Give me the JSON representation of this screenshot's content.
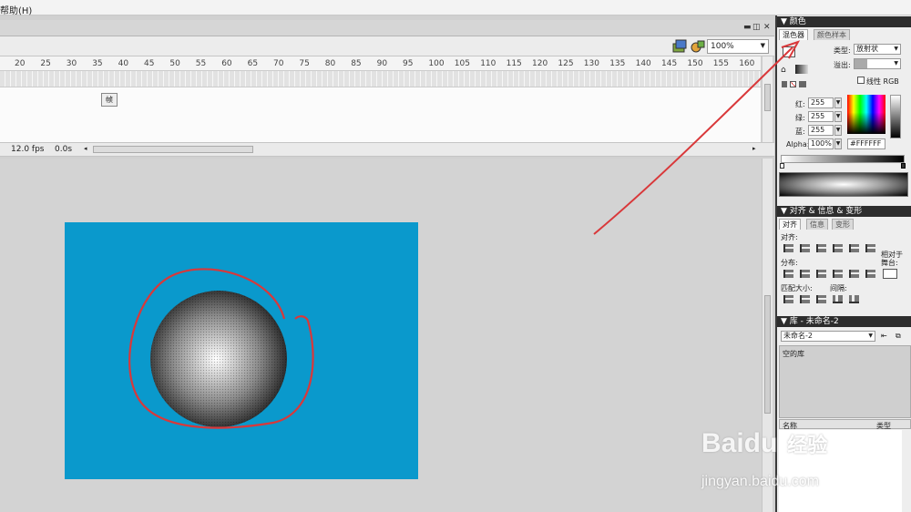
{
  "menu": {
    "help": "帮助(H)"
  },
  "timeline": {
    "zoom": "100%",
    "ruler_ticks": [
      "20",
      "25",
      "30",
      "35",
      "40",
      "45",
      "50",
      "55",
      "60",
      "65",
      "70",
      "75",
      "80",
      "85",
      "90",
      "95",
      "100",
      "105",
      "110",
      "115",
      "120",
      "125",
      "130",
      "135",
      "140",
      "145",
      "150",
      "155",
      "160"
    ],
    "frame_tag": "帧",
    "fps": "12.0 fps",
    "time": "0.0s"
  },
  "color_panel": {
    "title": "颜色",
    "tab_mixer": "混色器",
    "tab_swatches": "颜色样本",
    "type_label": "类型:",
    "type_value": "放射状",
    "overflow_label": "溢出:",
    "linear_rgb_label": "线性 RGB",
    "red_label": "红:",
    "red_value": "255",
    "green_label": "绿:",
    "green_value": "255",
    "blue_label": "蓝:",
    "blue_value": "255",
    "alpha_label": "Alpha:",
    "alpha_value": "100%",
    "hex_value": "#FFFFFF"
  },
  "align_panel": {
    "title": "对齐 & 信息 & 变形",
    "tab_align": "对齐",
    "tab_info": "信息",
    "tab_transform": "变形",
    "align_label": "对齐:",
    "distribute_label": "分布:",
    "match_size_label": "匹配大小:",
    "spacing_label": "间隔:",
    "relative_label": "相对于",
    "stage_label": "舞台:"
  },
  "library_panel": {
    "title": "库 - 未命名-2",
    "doc_select": "未命名-2",
    "empty_text": "空的库",
    "col_name": "名称",
    "col_type": "类型"
  },
  "watermark": {
    "brand": "Baidu",
    "brand_cn": "经验",
    "url": "jingyan.baidu.com"
  },
  "colors": {
    "stage": "#0a99cc",
    "annotation": "#d9383a",
    "panel_title": "#2d2d2d"
  }
}
